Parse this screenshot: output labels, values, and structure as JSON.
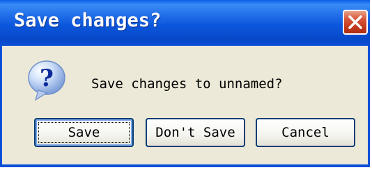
{
  "window": {
    "title": "Save changes?",
    "close_icon": "close-icon"
  },
  "dialog": {
    "icon": "question-icon",
    "message": "Save changes to unnamed?"
  },
  "buttons": {
    "save": "Save",
    "dont_save": "Don't Save",
    "cancel": "Cancel"
  },
  "colors": {
    "titlebar": "#0a56dc",
    "dialog_bg": "#ece9d8",
    "close_button": "#c9452a"
  }
}
